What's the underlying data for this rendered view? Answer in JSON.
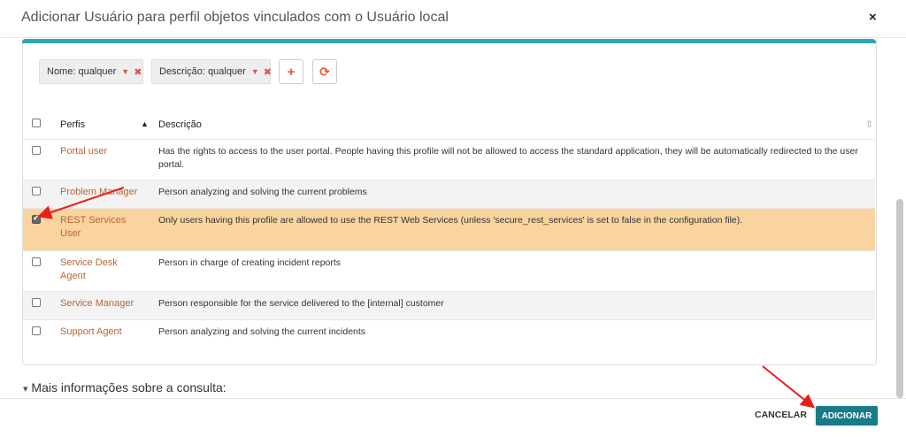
{
  "dialog": {
    "title": "Adicionar Usuário para perfil objetos vinculados com o Usuário local",
    "close_glyph": "×"
  },
  "filters": [
    {
      "label": "Nome: qualquer",
      "caret": "▼",
      "remove": "✖"
    },
    {
      "label": "Descrição: qualquer",
      "caret": "▼",
      "remove": "✖"
    }
  ],
  "toolbar": {
    "add_glyph": "+",
    "refresh_glyph": "⟳"
  },
  "table": {
    "headers": {
      "profile": "Perfis",
      "sort_indicator": "▲",
      "description": "Descrição",
      "sortable_indicator": "⇕"
    },
    "rows": [
      {
        "name": "Portal user",
        "description": "Has the rights to access to the user portal. People having this profile will not be allowed to access the standard application, they will be automatically redirected to the user portal.",
        "checked": false
      },
      {
        "name": "Problem Manager",
        "description": "Person analyzing and solving the current problems",
        "checked": false
      },
      {
        "name": "REST Services User",
        "description": "Only users having this profile are allowed to use the REST Web Services (unless 'secure_rest_services' is set to false in the configuration file).",
        "checked": true
      },
      {
        "name": "Service Desk Agent",
        "description": "Person in charge of creating incident reports",
        "checked": false
      },
      {
        "name": "Service Manager",
        "description": "Person responsible for the service delivered to the [internal] customer",
        "checked": false
      },
      {
        "name": "Support Agent",
        "description": "Person analyzing and solving the current incidents",
        "checked": false
      }
    ]
  },
  "more_info": {
    "caret": "▾",
    "label": "Mais informações sobre a consulta:"
  },
  "footer": {
    "cancel_label": "CANCELAR",
    "add_label": "ADICIONAR"
  },
  "colors": {
    "accent": "#2da6b8",
    "add_button": "#1b7a87",
    "link": "#b9653a",
    "selected_row": "#f9d49f",
    "alt_row": "#f3f3f3",
    "annotation": "#e8201c"
  }
}
